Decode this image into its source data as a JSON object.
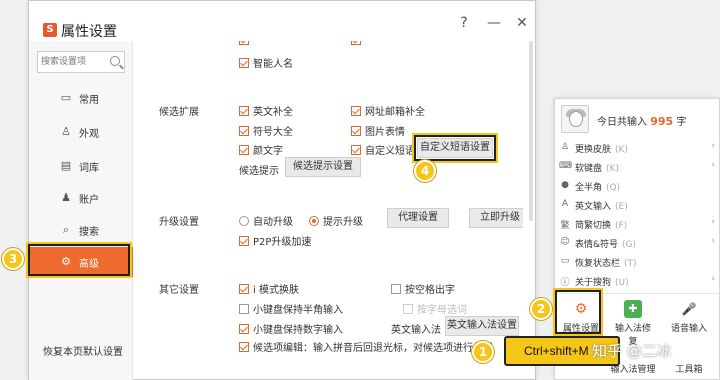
{
  "window": {
    "title": "属性设置",
    "logo": "S",
    "help_label": "?",
    "minimize_label": "—",
    "close_label": "✕"
  },
  "sidebar": {
    "search_placeholder": "搜索设置项",
    "items": [
      {
        "label": "常用",
        "icon": "monitor-icon",
        "glyph": "▭"
      },
      {
        "label": "外观",
        "icon": "shirt-icon",
        "glyph": "♙"
      },
      {
        "label": "词库",
        "icon": "book-icon",
        "glyph": "▤"
      },
      {
        "label": "账户",
        "icon": "user-icon",
        "glyph": "♟"
      },
      {
        "label": "搜索",
        "icon": "search-icon",
        "glyph": "⌕"
      },
      {
        "label": "高级",
        "icon": "gear-icon",
        "glyph": "⚙"
      }
    ],
    "restore_label": "恢复本页默认设置"
  },
  "content": {
    "top_partial": [
      {
        "label": "智能人名",
        "checked": true
      }
    ],
    "candidate": {
      "title": "候选扩展",
      "options": [
        {
          "label": "英文补全",
          "checked": true
        },
        {
          "label": "网址邮箱补全",
          "checked": true
        },
        {
          "label": "符号大全",
          "checked": true
        },
        {
          "label": "图片表情",
          "checked": true
        },
        {
          "label": "颜文字",
          "checked": true
        },
        {
          "label": "自定义短语",
          "checked": true
        }
      ],
      "custom_phrase_button": "自定义短语设置",
      "hint_label": "候选提示",
      "hint_button": "候选提示设置"
    },
    "upgrade": {
      "title": "升级设置",
      "auto_label": "自动升级",
      "prompt_label": "提示升级",
      "proxy_button": "代理设置",
      "now_button": "立即升级",
      "p2p_label": "P2P升级加速",
      "p2p_checked": true
    },
    "other": {
      "title": "其它设置",
      "options": [
        {
          "label": "i 模式换肤",
          "checked": true,
          "disabled": false
        },
        {
          "label": "按空格出字",
          "checked": false,
          "disabled": false
        },
        {
          "label": "小键盘保持半角输入",
          "checked": false,
          "disabled": false
        },
        {
          "label": "按字母选词",
          "checked": false,
          "disabled": true
        },
        {
          "label": "小键盘保持数字输入",
          "checked": true,
          "disabled": false
        },
        {
          "label": "候选项编辑：输入拼音后回退光标，对候选项进行编辑",
          "checked": true,
          "disabled": false
        }
      ],
      "en_method_label": "英文输入法",
      "en_method_button": "英文输入法设置"
    }
  },
  "badges": [
    "1",
    "2",
    "3",
    "4"
  ],
  "panel": {
    "today_prefix": "今日共输入",
    "today_count": "995",
    "today_suffix": "字",
    "menu": [
      {
        "label": "更换皮肤",
        "shortcut": "(K)",
        "icon": "shirt-icon",
        "glyph": "♙"
      },
      {
        "label": "软键盘",
        "shortcut": "(K)",
        "icon": "keyboard-icon",
        "glyph": "⌨"
      },
      {
        "label": "全半角",
        "shortcut": "(Q)",
        "icon": "moon-icon",
        "glyph": "●"
      },
      {
        "label": "英文输入",
        "shortcut": "(E)",
        "icon": "english-icon",
        "glyph": "A"
      },
      {
        "label": "简繁切换",
        "shortcut": "(F)",
        "icon": "convert-icon",
        "glyph": "繁"
      },
      {
        "label": "表情&符号",
        "shortcut": "(G)",
        "icon": "emoji-icon",
        "glyph": "☺"
      },
      {
        "label": "恢复状态栏",
        "shortcut": "(T)",
        "icon": "statusbar-icon",
        "glyph": "▭"
      },
      {
        "label": "关于搜狗",
        "shortcut": "(U)",
        "icon": "info-icon",
        "glyph": "ⓘ"
      }
    ],
    "bottom": [
      {
        "label": "属性设置",
        "icon": "settings-gear-icon",
        "glyph": "⚙",
        "color": "#ef6a2e"
      },
      {
        "label": "输入法修复",
        "icon": "repair-icon",
        "glyph": "✚",
        "color": "#4caf50"
      },
      {
        "label": "语音输入",
        "icon": "microphone-icon",
        "glyph": "🎤",
        "color": "#2b8be0"
      }
    ],
    "bottom_row2": [
      {
        "label": "输入法管理"
      },
      {
        "label": "工具箱"
      }
    ]
  },
  "shortcut_label": "Ctrl+shift+M",
  "watermark": "知乎 @二冰",
  "colors": {
    "accent": "#ef6a2e",
    "highlight": "#f5c518"
  }
}
